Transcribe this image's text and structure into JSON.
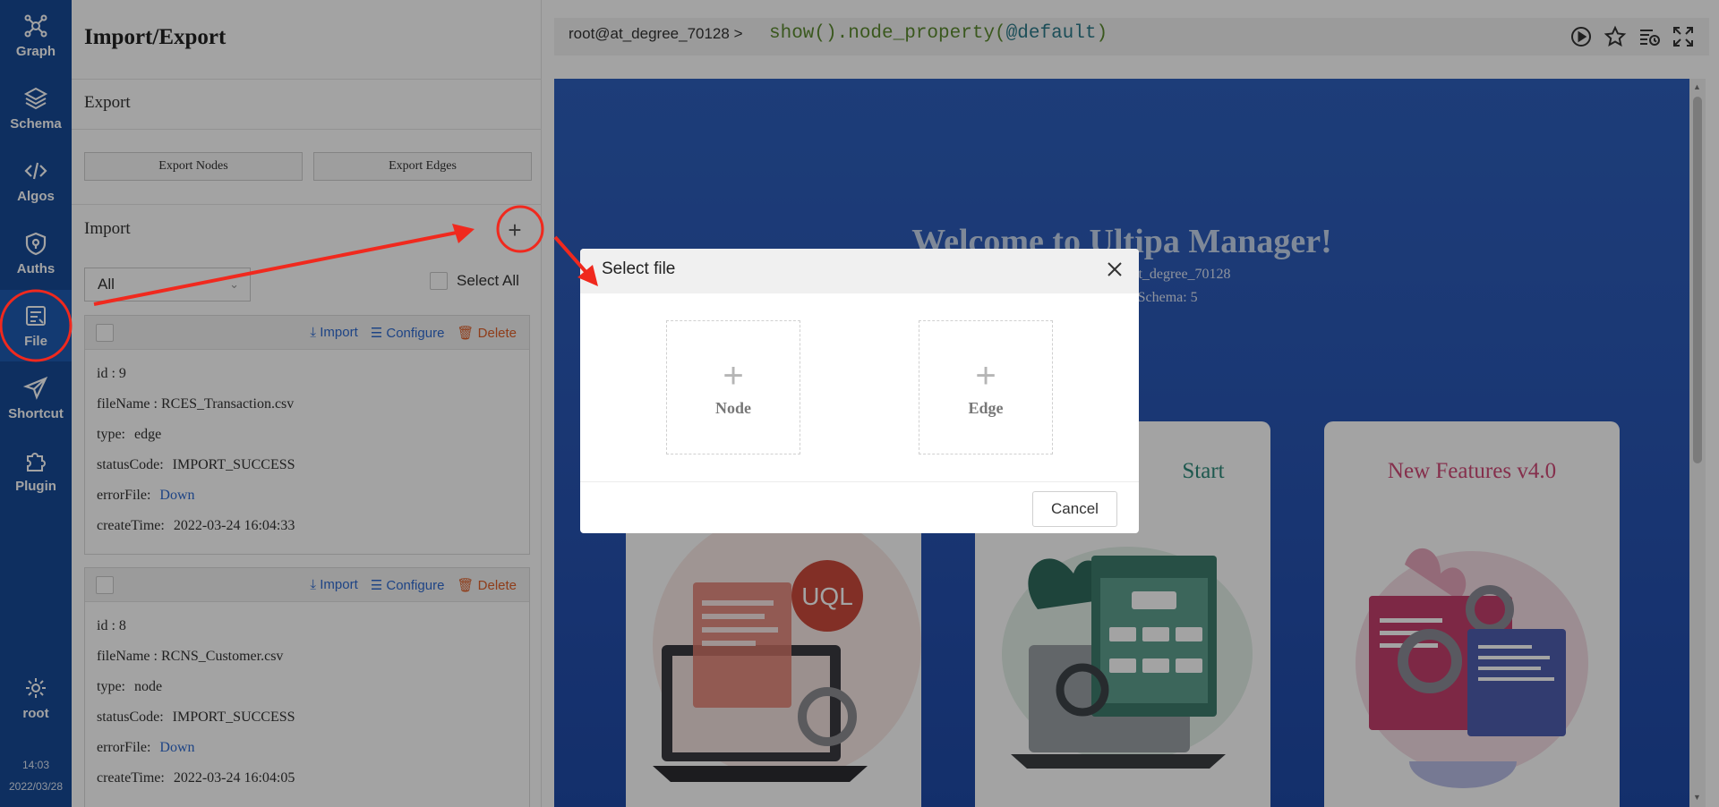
{
  "nav": {
    "items": [
      {
        "label": "Graph",
        "icon": "graph-icon"
      },
      {
        "label": "Schema",
        "icon": "layers-icon"
      },
      {
        "label": "Algos",
        "icon": "code-icon"
      },
      {
        "label": "Auths",
        "icon": "shield-icon"
      },
      {
        "label": "File",
        "icon": "file-icon",
        "active": true
      },
      {
        "label": "Shortcut",
        "icon": "send-icon"
      },
      {
        "label": "Plugin",
        "icon": "puzzle-icon"
      }
    ],
    "user": {
      "label": "root",
      "icon": "gear-icon"
    },
    "time": "14:03",
    "date": "2022/03/28"
  },
  "panel": {
    "title": "Import/Export",
    "export_label": "Export",
    "export_nodes": "Export Nodes",
    "export_edges": "Export Edges",
    "import_label": "Import",
    "filter_value": "All",
    "select_all": "Select All",
    "actions": {
      "import": "Import",
      "configure": "Configure",
      "delete": "Delete"
    },
    "cards": [
      {
        "id_label": "id : 9",
        "filename_label": "fileName : RCES_Transaction.csv",
        "type_key": "type:",
        "type_val": "edge",
        "status_key": "statusCode:",
        "status_val": "IMPORT_SUCCESS",
        "error_key": "errorFile:",
        "error_val": "Down",
        "time_key": "createTime:",
        "time_val": "2022-03-24 16:04:33"
      },
      {
        "id_label": "id : 8",
        "filename_label": "fileName : RCNS_Customer.csv",
        "type_key": "type:",
        "type_val": "node",
        "status_key": "statusCode:",
        "status_val": "IMPORT_SUCCESS",
        "error_key": "errorFile:",
        "error_val": "Down",
        "time_key": "createTime:",
        "time_val": "2022-03-24 16:04:05"
      }
    ]
  },
  "console": {
    "prompt": "root@at_degree_70128 >",
    "command_fn": "show().node_property(",
    "command_arg": "@default",
    "command_end": ")",
    "icons": [
      "play-icon",
      "star-icon",
      "history-icon",
      "fullscreen-icon"
    ]
  },
  "welcome": {
    "title": "Welcome to Ultipa Manager!",
    "line1": "oot | Current Graph: at_degree_70128",
    "line2": "chema: 2 | EdgeSchema: 5",
    "cards": [
      {
        "title": "",
        "badge": "UQL",
        "color": "#cc4a3c"
      },
      {
        "title": "Start",
        "color": "#2e8a7a"
      },
      {
        "title": "New Features v4.0",
        "color": "#d14a78"
      }
    ]
  },
  "modal": {
    "title": "Select file",
    "node_label": "Node",
    "edge_label": "Edge",
    "cancel": "Cancel"
  },
  "colors": {
    "nav_bg": "#174a97",
    "accent_blue": "#2f6bd1",
    "delete_orange": "#e0602a",
    "annotation_red": "#f0291e"
  }
}
